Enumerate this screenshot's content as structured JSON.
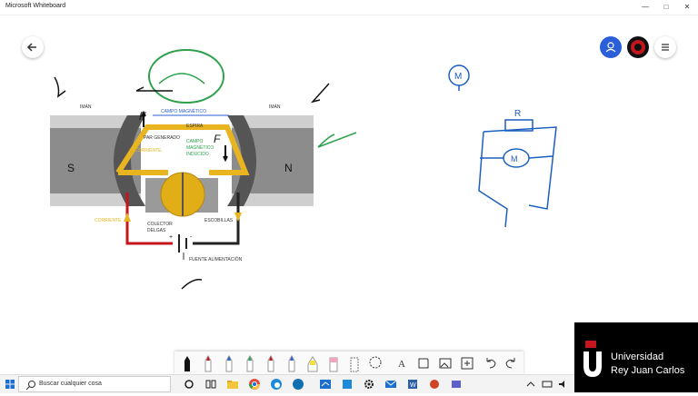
{
  "app": {
    "title": "Microsoft Whiteboard"
  },
  "window_controls": {
    "minimize": "—",
    "maximize": "□",
    "close": "✕"
  },
  "diagram": {
    "iman_left": "IMÁN",
    "iman_right": "IMÁN",
    "campo_magnetico": "CAMPO MAGNÉTICO",
    "espira": "ESPIRA",
    "par_generado": "PAR GENERADO",
    "corriente_inner": "CORRIENTE",
    "campo_inducido_1": "CAMPO",
    "campo_inducido_2": "MAGNÉTICO",
    "campo_inducido_3": "INDUCIDO",
    "pole_s": "S",
    "pole_n": "N",
    "corriente_left": "CORRIENTE",
    "colector_1": "COLECTOR",
    "colector_2": "DELGAS",
    "escobillas": "ESCOBILLAS",
    "fuente": "FUENTE ALIMENTACIÓN",
    "plus": "+",
    "minus": "-"
  },
  "handwriting": {
    "f_left": "F",
    "f_right": "F",
    "m_top": "M",
    "r_label": "R",
    "m_circuit": "M"
  },
  "toolbar": {
    "tools": [
      "pen-black",
      "pen-red",
      "pen-blue",
      "pen-green",
      "pen-red-2",
      "pen-blue-2",
      "highlighter-yellow",
      "highlighter-pink",
      "eraser",
      "lasso",
      "text",
      "shapes",
      "image",
      "insert",
      "undo",
      "redo"
    ]
  },
  "taskbar": {
    "search_placeholder": "Buscar cualquier cosa"
  },
  "branding": {
    "line1": "Universidad",
    "line2": "Rey Juan Carlos"
  },
  "colors": {
    "accent_blue": "#2b5fd9",
    "green_ink": "#2ca14a",
    "blue_ink": "#1c5fc0",
    "yellow": "#e8b520",
    "red": "#c4161c"
  }
}
